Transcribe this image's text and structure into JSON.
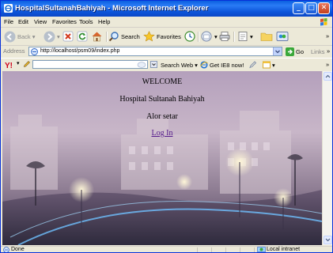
{
  "window": {
    "title": "HospitalSultanahBahiyah - Microsoft Internet Explorer",
    "minimize_glyph": "_",
    "maximize_glyph": "□",
    "close_glyph": "✕"
  },
  "menu": [
    "File",
    "Edit",
    "View",
    "Favorites",
    "Tools",
    "Help"
  ],
  "toolbar": {
    "back_label": "Back",
    "search_label": "Search",
    "favorites_label": "Favorites",
    "overflow": "»"
  },
  "address": {
    "label": "Address",
    "url": "http://localhost/psm09/index.php",
    "go_label": "Go",
    "links_label": "Links",
    "overflow": "»"
  },
  "searchbar": {
    "search_web_label": "Search Web",
    "ie8_label": "Get IE8 now!",
    "search_value": "",
    "overflow": "»"
  },
  "page": {
    "welcome": "WELCOME",
    "hospital_name": "Hospital Sultanah Bahiyah",
    "location": "Alor setar",
    "login_link": "Log In"
  },
  "status": {
    "text": "Done",
    "zone": "Local intranet"
  },
  "colors": {
    "title_bar": "#0a5fe0",
    "link_visited": "#551a8b",
    "chrome": "#ece9d8"
  }
}
